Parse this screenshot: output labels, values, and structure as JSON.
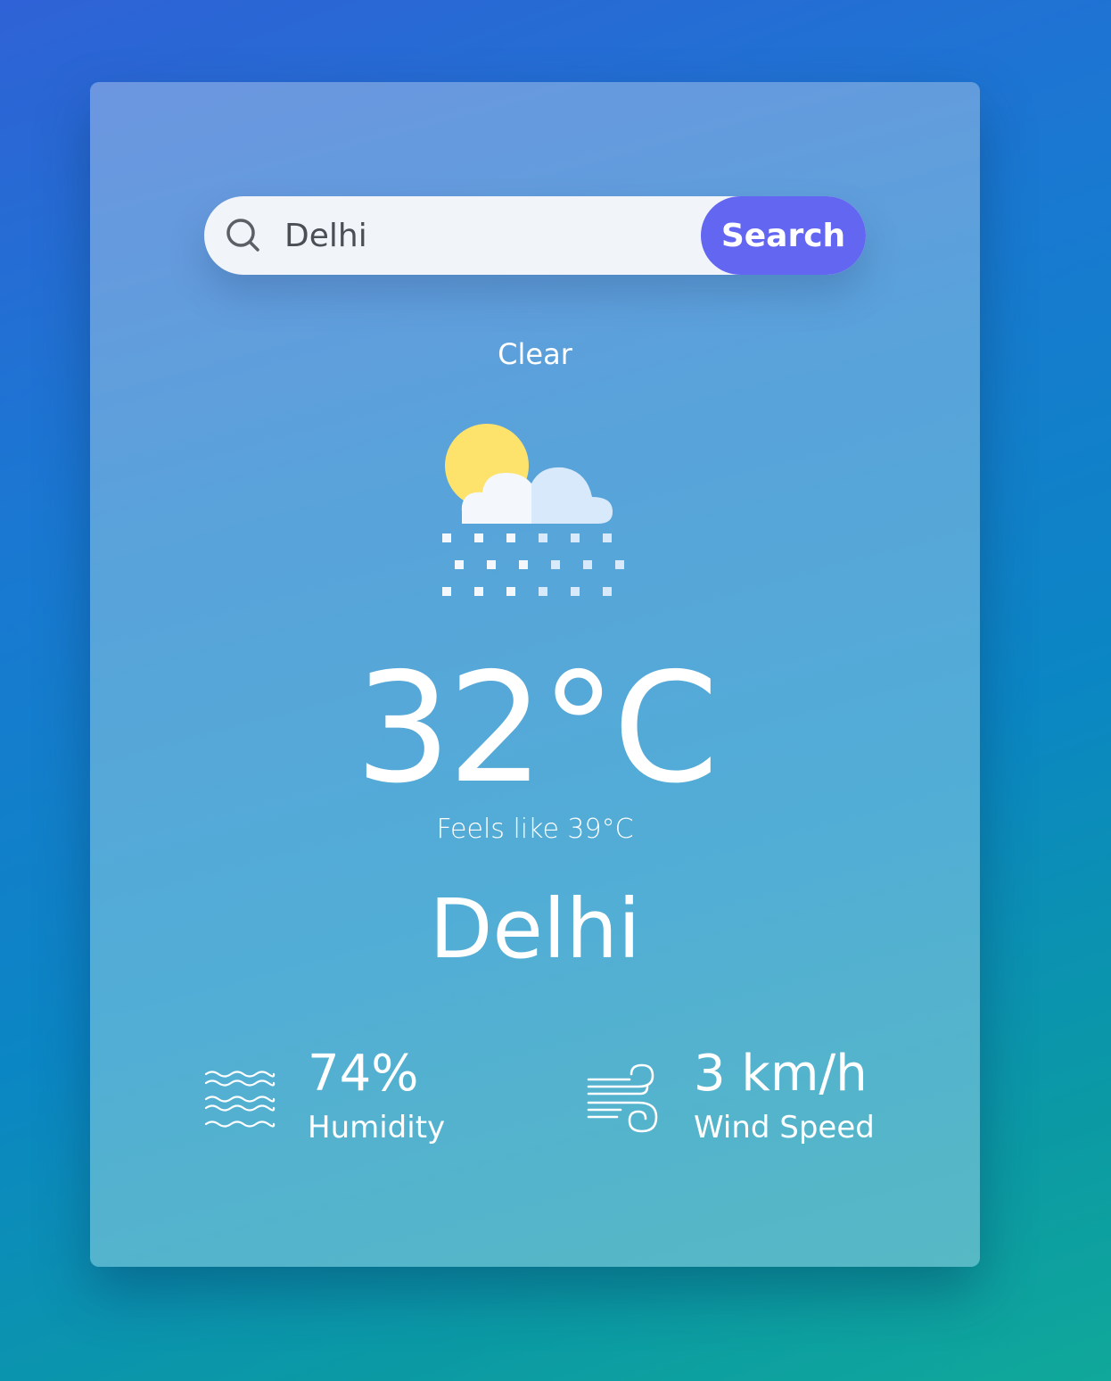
{
  "search": {
    "value": "Delhi",
    "button_label": "Search",
    "icon": "search-icon"
  },
  "weather": {
    "condition": "Clear",
    "icon": "partly-cloudy-snow-icon",
    "temperature": "32°C",
    "feels_like": "Feels like 39°C",
    "city": "Delhi"
  },
  "stats": {
    "humidity": {
      "value": "74%",
      "label": "Humidity",
      "icon": "humidity-waves-icon"
    },
    "wind": {
      "value": "3 km/h",
      "label": "Wind Speed",
      "icon": "wind-icon"
    }
  },
  "colors": {
    "accent": "#6366f1",
    "card_top": "#6c96e0",
    "card_bottom": "#56b9c4",
    "text": "#ffffff"
  }
}
